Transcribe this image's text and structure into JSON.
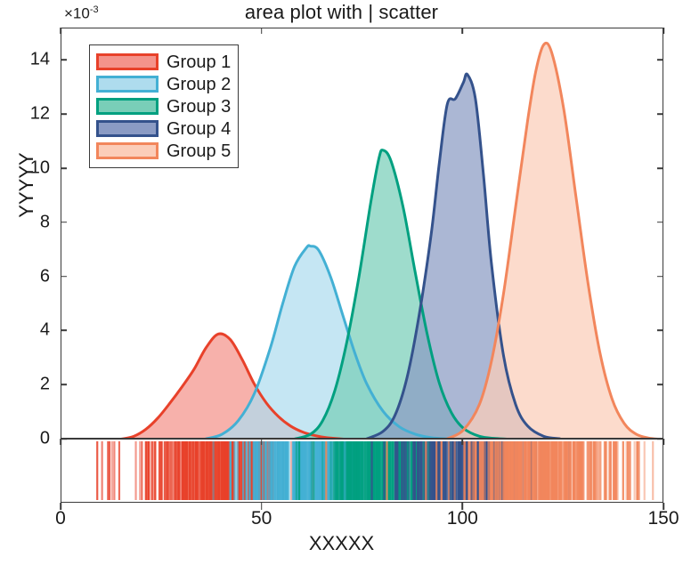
{
  "chart_data": {
    "type": "area",
    "title": "area plot with | scatter",
    "xlabel": "XXXXX",
    "ylabel": "YYYYY",
    "y_exponent_label": "×10",
    "y_exponent_power": "-3",
    "xlim": [
      0,
      150
    ],
    "ylim": [
      0,
      15.2
    ],
    "xticks": [
      0,
      50,
      100,
      150
    ],
    "xtick_labels": [
      "0",
      "50",
      "100",
      "150"
    ],
    "yticks": [
      0,
      2,
      4,
      6,
      8,
      10,
      12,
      14
    ],
    "ytick_labels": [
      "0",
      "2",
      "4",
      "6",
      "8",
      "10",
      "12",
      "14"
    ],
    "grid": false,
    "legend_position": "upper left",
    "y_scale_note": "values are in units of 1e-3",
    "series": [
      {
        "name": "Group 1",
        "fill": "#F4938B",
        "stroke": "#E8412A",
        "peak_x": 39,
        "peak_y": 3.9,
        "x": [
          15,
          18,
          21,
          24,
          27,
          30,
          33,
          36,
          39,
          42,
          45,
          48,
          51,
          54,
          57,
          60,
          63,
          66,
          70
        ],
        "values": [
          0.02,
          0.12,
          0.38,
          0.8,
          1.35,
          1.95,
          2.6,
          3.4,
          3.9,
          3.7,
          2.95,
          2.05,
          1.35,
          0.85,
          0.5,
          0.28,
          0.15,
          0.07,
          0.02
        ]
      },
      {
        "name": "Group 2",
        "fill": "#AEDCEE",
        "stroke": "#43B0D4",
        "peak_x": 62,
        "peak_y": 7.15,
        "x": [
          36,
          40,
          44,
          48,
          52,
          55,
          58,
          61,
          62,
          64,
          67,
          70,
          73,
          76,
          80,
          84,
          88,
          92,
          96
        ],
        "values": [
          0.03,
          0.2,
          0.7,
          1.7,
          3.4,
          5.0,
          6.4,
          7.1,
          7.15,
          7.0,
          6.0,
          4.6,
          3.2,
          2.05,
          1.05,
          0.48,
          0.2,
          0.07,
          0.02
        ]
      },
      {
        "name": "Group 3",
        "fill": "#79CEB8",
        "stroke": "#00A080",
        "peak_x": 80,
        "peak_y": 10.7,
        "x": [
          58,
          62,
          65,
          68,
          71,
          74,
          77,
          79,
          80,
          82,
          85,
          88,
          91,
          94,
          97,
          100,
          104,
          108,
          112
        ],
        "values": [
          0.02,
          0.2,
          0.7,
          1.8,
          3.6,
          6.0,
          8.8,
          10.4,
          10.7,
          10.3,
          8.6,
          6.2,
          3.9,
          2.1,
          1.0,
          0.42,
          0.12,
          0.04,
          0.01
        ]
      },
      {
        "name": "Group 4",
        "fill": "#8B9BC4",
        "stroke": "#34528C",
        "peak_x": 101,
        "peak_y": 13.5,
        "shape_note": "bimodal with left shoulder near x=96",
        "x": [
          76,
          80,
          83,
          86,
          89,
          92,
          94,
          96,
          98,
          100,
          101,
          103,
          105,
          107,
          110,
          113,
          116,
          120,
          124
        ],
        "values": [
          0.03,
          0.3,
          0.9,
          2.3,
          4.6,
          7.6,
          10.2,
          12.4,
          12.6,
          13.2,
          13.5,
          12.6,
          9.8,
          6.5,
          3.1,
          1.3,
          0.5,
          0.12,
          0.03
        ]
      },
      {
        "name": "Group 5",
        "fill": "#FBCDB9",
        "stroke": "#F2865C",
        "peak_x": 120,
        "peak_y": 14.6,
        "x": [
          96,
          100,
          104,
          107,
          110,
          113,
          116,
          118,
          120,
          122,
          125,
          128,
          131,
          134,
          137,
          140,
          143,
          146,
          149
        ],
        "values": [
          0.03,
          0.35,
          1.3,
          2.9,
          5.4,
          8.6,
          11.8,
          13.6,
          14.6,
          14.3,
          12.2,
          9.0,
          5.8,
          3.2,
          1.5,
          0.6,
          0.2,
          0.06,
          0.01
        ]
      }
    ],
    "rug": {
      "note": "scatter / rug strip below the main axes showing individual observations per group",
      "x_range": [
        18,
        145
      ],
      "groups": [
        {
          "name": "Group 1",
          "color": "#E8412A",
          "x_range": [
            19,
            52
          ]
        },
        {
          "name": "Group 2",
          "color": "#43B0D4",
          "x_range": [
            40,
            78
          ]
        },
        {
          "name": "Group 3",
          "color": "#00A080",
          "x_range": [
            58,
            95
          ]
        },
        {
          "name": "Group 4",
          "color": "#34528C",
          "x_range": [
            78,
            120
          ]
        },
        {
          "name": "Group 5",
          "color": "#F2865C",
          "x_range": [
            96,
            145
          ]
        }
      ]
    },
    "legend_entries": [
      "Group 1",
      "Group 2",
      "Group 3",
      "Group 4",
      "Group 5"
    ]
  }
}
